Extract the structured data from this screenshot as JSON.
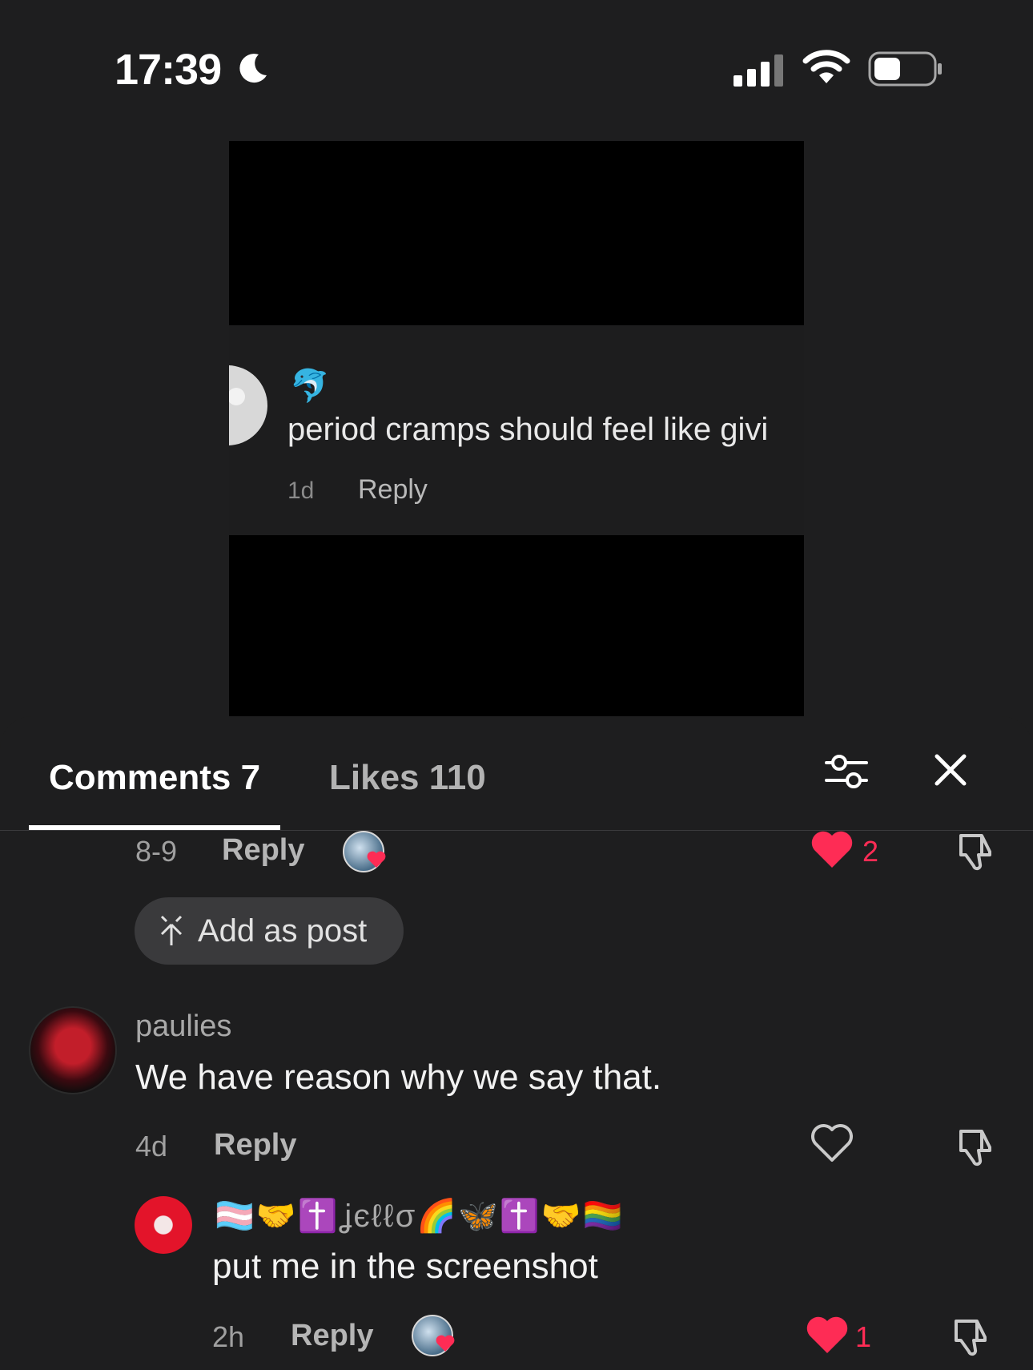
{
  "status_bar": {
    "time": "17:39"
  },
  "video_preview": {
    "username_emoji": "🐬",
    "comment_text": "period cramps should feel like givi",
    "time": "1d",
    "reply_label": "Reply"
  },
  "tabs": {
    "comments_label": "Comments 7",
    "likes_label": "Likes 110"
  },
  "comments": [
    {
      "time": "8-9",
      "reply_label": "Reply",
      "liked": true,
      "like_count": "2"
    },
    {
      "username": "paulies",
      "text": "We have reason why we say that.",
      "time": "4d",
      "reply_label": "Reply",
      "liked": false
    },
    {
      "username": "🏳️‍⚧️🤝✝️ʝєℓℓσ🌈🦋✝️🤝🏳️‍🌈",
      "text": "put me in the screenshot",
      "time": "2h",
      "reply_label": "Reply",
      "liked": true,
      "like_count": "1"
    }
  ],
  "add_as_post_label": "Add as post",
  "colors": {
    "accent_like": "#fe2c55",
    "background": "#1e1e1f"
  }
}
